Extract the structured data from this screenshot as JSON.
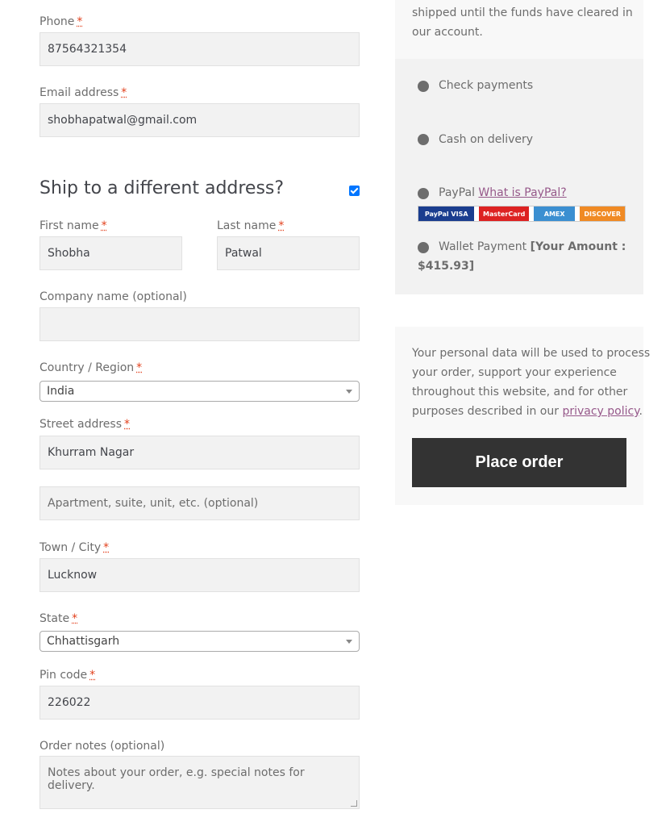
{
  "billing": {
    "phone": {
      "label": "Phone",
      "value": "87564321354"
    },
    "email": {
      "label": "Email address",
      "value": "shobhapatwal@gmail.com"
    }
  },
  "required_mark": "*",
  "shipping": {
    "title": "Ship to a different address?",
    "checked": true,
    "first_name": {
      "label": "First name",
      "value": "Shobha"
    },
    "last_name": {
      "label": "Last name",
      "value": "Patwal"
    },
    "company": {
      "label": "Company name (optional)",
      "value": ""
    },
    "country": {
      "label": "Country / Region",
      "value": "India"
    },
    "street": {
      "label": "Street address",
      "value": "Khurram Nagar",
      "placeholder2": "Apartment, suite, unit, etc. (optional)"
    },
    "city": {
      "label": "Town / City",
      "value": "Lucknow"
    },
    "state": {
      "label": "State",
      "value": "Chhattisgarh"
    },
    "pin": {
      "label": "Pin code",
      "value": "226022"
    }
  },
  "order_notes": {
    "label": "Order notes (optional)",
    "placeholder": "Notes about your order, e.g. special notes for delivery."
  },
  "payment": {
    "bank_note_line1": "shipped until the funds have cleared in",
    "bank_note_line2": "our account.",
    "methods": [
      {
        "label": "Check payments"
      },
      {
        "label": "Cash on delivery"
      },
      {
        "label": "PayPal",
        "link": "What is PayPal?"
      },
      {
        "label": "Wallet Payment",
        "amount_label": "[Your Amount :",
        "amount_value": "$415.93]"
      }
    ],
    "card_logos": [
      "PayPal VISA",
      "MasterCard",
      "AMEX",
      "DISCOVER"
    ]
  },
  "privacy": {
    "line1": "Your personal data will be used to process",
    "line2": "your order, support your experience",
    "line3": "throughout this website, and for other",
    "line4_prefix": "purposes described in our",
    "link": "privacy policy",
    "suffix": "."
  },
  "place_order_label": "Place order",
  "colors": {
    "accent_link": "#96588a",
    "button_bg": "#333333",
    "required": "#e2401c",
    "checkbox": "#0075ff"
  }
}
